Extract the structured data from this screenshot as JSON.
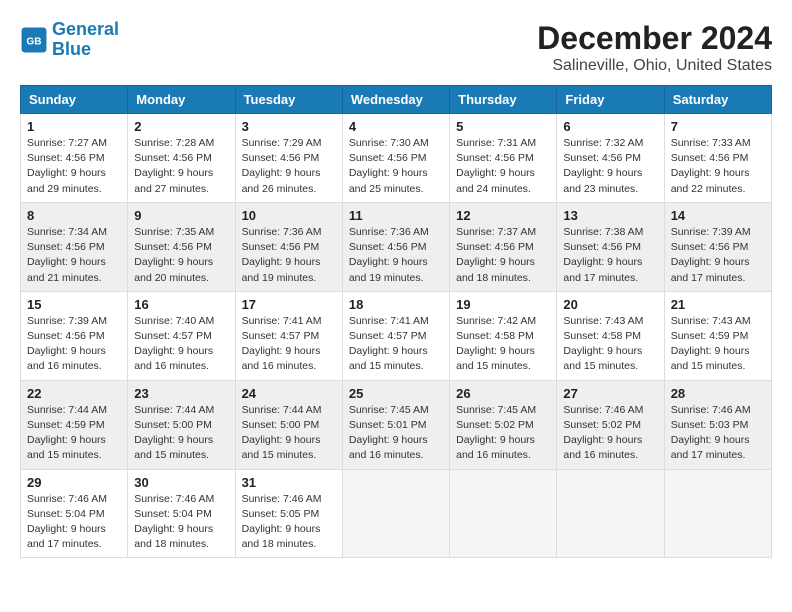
{
  "logo": {
    "line1": "General",
    "line2": "Blue"
  },
  "title": "December 2024",
  "subtitle": "Salineville, Ohio, United States",
  "headers": [
    "Sunday",
    "Monday",
    "Tuesday",
    "Wednesday",
    "Thursday",
    "Friday",
    "Saturday"
  ],
  "weeks": [
    [
      {
        "day": "1",
        "text": "Sunrise: 7:27 AM\nSunset: 4:56 PM\nDaylight: 9 hours\nand 29 minutes."
      },
      {
        "day": "2",
        "text": "Sunrise: 7:28 AM\nSunset: 4:56 PM\nDaylight: 9 hours\nand 27 minutes."
      },
      {
        "day": "3",
        "text": "Sunrise: 7:29 AM\nSunset: 4:56 PM\nDaylight: 9 hours\nand 26 minutes."
      },
      {
        "day": "4",
        "text": "Sunrise: 7:30 AM\nSunset: 4:56 PM\nDaylight: 9 hours\nand 25 minutes."
      },
      {
        "day": "5",
        "text": "Sunrise: 7:31 AM\nSunset: 4:56 PM\nDaylight: 9 hours\nand 24 minutes."
      },
      {
        "day": "6",
        "text": "Sunrise: 7:32 AM\nSunset: 4:56 PM\nDaylight: 9 hours\nand 23 minutes."
      },
      {
        "day": "7",
        "text": "Sunrise: 7:33 AM\nSunset: 4:56 PM\nDaylight: 9 hours\nand 22 minutes."
      }
    ],
    [
      {
        "day": "8",
        "text": "Sunrise: 7:34 AM\nSunset: 4:56 PM\nDaylight: 9 hours\nand 21 minutes."
      },
      {
        "day": "9",
        "text": "Sunrise: 7:35 AM\nSunset: 4:56 PM\nDaylight: 9 hours\nand 20 minutes."
      },
      {
        "day": "10",
        "text": "Sunrise: 7:36 AM\nSunset: 4:56 PM\nDaylight: 9 hours\nand 19 minutes."
      },
      {
        "day": "11",
        "text": "Sunrise: 7:36 AM\nSunset: 4:56 PM\nDaylight: 9 hours\nand 19 minutes."
      },
      {
        "day": "12",
        "text": "Sunrise: 7:37 AM\nSunset: 4:56 PM\nDaylight: 9 hours\nand 18 minutes."
      },
      {
        "day": "13",
        "text": "Sunrise: 7:38 AM\nSunset: 4:56 PM\nDaylight: 9 hours\nand 17 minutes."
      },
      {
        "day": "14",
        "text": "Sunrise: 7:39 AM\nSunset: 4:56 PM\nDaylight: 9 hours\nand 17 minutes."
      }
    ],
    [
      {
        "day": "15",
        "text": "Sunrise: 7:39 AM\nSunset: 4:56 PM\nDaylight: 9 hours\nand 16 minutes."
      },
      {
        "day": "16",
        "text": "Sunrise: 7:40 AM\nSunset: 4:57 PM\nDaylight: 9 hours\nand 16 minutes."
      },
      {
        "day": "17",
        "text": "Sunrise: 7:41 AM\nSunset: 4:57 PM\nDaylight: 9 hours\nand 16 minutes."
      },
      {
        "day": "18",
        "text": "Sunrise: 7:41 AM\nSunset: 4:57 PM\nDaylight: 9 hours\nand 15 minutes."
      },
      {
        "day": "19",
        "text": "Sunrise: 7:42 AM\nSunset: 4:58 PM\nDaylight: 9 hours\nand 15 minutes."
      },
      {
        "day": "20",
        "text": "Sunrise: 7:43 AM\nSunset: 4:58 PM\nDaylight: 9 hours\nand 15 minutes."
      },
      {
        "day": "21",
        "text": "Sunrise: 7:43 AM\nSunset: 4:59 PM\nDaylight: 9 hours\nand 15 minutes."
      }
    ],
    [
      {
        "day": "22",
        "text": "Sunrise: 7:44 AM\nSunset: 4:59 PM\nDaylight: 9 hours\nand 15 minutes."
      },
      {
        "day": "23",
        "text": "Sunrise: 7:44 AM\nSunset: 5:00 PM\nDaylight: 9 hours\nand 15 minutes."
      },
      {
        "day": "24",
        "text": "Sunrise: 7:44 AM\nSunset: 5:00 PM\nDaylight: 9 hours\nand 15 minutes."
      },
      {
        "day": "25",
        "text": "Sunrise: 7:45 AM\nSunset: 5:01 PM\nDaylight: 9 hours\nand 16 minutes."
      },
      {
        "day": "26",
        "text": "Sunrise: 7:45 AM\nSunset: 5:02 PM\nDaylight: 9 hours\nand 16 minutes."
      },
      {
        "day": "27",
        "text": "Sunrise: 7:46 AM\nSunset: 5:02 PM\nDaylight: 9 hours\nand 16 minutes."
      },
      {
        "day": "28",
        "text": "Sunrise: 7:46 AM\nSunset: 5:03 PM\nDaylight: 9 hours\nand 17 minutes."
      }
    ],
    [
      {
        "day": "29",
        "text": "Sunrise: 7:46 AM\nSunset: 5:04 PM\nDaylight: 9 hours\nand 17 minutes."
      },
      {
        "day": "30",
        "text": "Sunrise: 7:46 AM\nSunset: 5:04 PM\nDaylight: 9 hours\nand 18 minutes."
      },
      {
        "day": "31",
        "text": "Sunrise: 7:46 AM\nSunset: 5:05 PM\nDaylight: 9 hours\nand 18 minutes."
      },
      {
        "day": "",
        "text": ""
      },
      {
        "day": "",
        "text": ""
      },
      {
        "day": "",
        "text": ""
      },
      {
        "day": "",
        "text": ""
      }
    ]
  ]
}
